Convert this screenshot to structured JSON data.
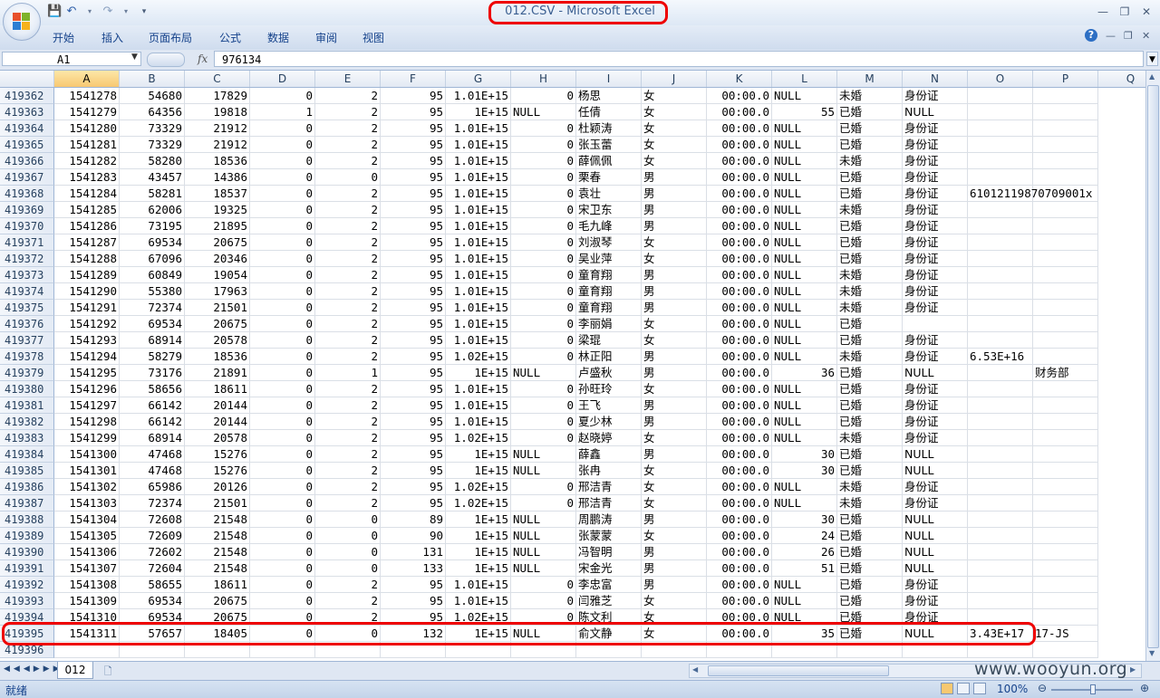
{
  "window": {
    "title": "012.CSV - Microsoft Excel",
    "colors": {
      "accent": "#15428b",
      "highlight": "#e00000",
      "selected_header": "#f7c871"
    }
  },
  "ribbon": {
    "tabs": [
      "开始",
      "插入",
      "页面布局",
      "公式",
      "数据",
      "审阅",
      "视图"
    ]
  },
  "formula_bar": {
    "name_box": "A1",
    "fx": "fx",
    "value": "976134"
  },
  "columns": [
    "A",
    "B",
    "C",
    "D",
    "E",
    "F",
    "G",
    "H",
    "I",
    "J",
    "K",
    "L",
    "M",
    "N",
    "O",
    "P",
    "Q"
  ],
  "rows": [
    [
      "419362",
      "1541278",
      "54680",
      "17829",
      "0",
      "2",
      "95",
      "1.01E+15",
      "0",
      "杨思",
      "女",
      "00:00.0",
      "NULL",
      "未婚",
      "身份证",
      "",
      ""
    ],
    [
      "419363",
      "1541279",
      "64356",
      "19818",
      "1",
      "2",
      "95",
      "1E+15",
      "NULL",
      "任倩",
      "女",
      "00:00.0",
      "55",
      "已婚",
      "NULL",
      "",
      ""
    ],
    [
      "419364",
      "1541280",
      "73329",
      "21912",
      "0",
      "2",
      "95",
      "1.01E+15",
      "0",
      "杜颖涛",
      "女",
      "00:00.0",
      "NULL",
      "已婚",
      "身份证",
      "",
      ""
    ],
    [
      "419365",
      "1541281",
      "73329",
      "21912",
      "0",
      "2",
      "95",
      "1.01E+15",
      "0",
      "张玉蕾",
      "女",
      "00:00.0",
      "NULL",
      "已婚",
      "身份证",
      "",
      ""
    ],
    [
      "419366",
      "1541282",
      "58280",
      "18536",
      "0",
      "2",
      "95",
      "1.01E+15",
      "0",
      "薛佩佩",
      "女",
      "00:00.0",
      "NULL",
      "未婚",
      "身份证",
      "",
      ""
    ],
    [
      "419367",
      "1541283",
      "43457",
      "14386",
      "0",
      "0",
      "95",
      "1.01E+15",
      "0",
      "栗春",
      "男",
      "00:00.0",
      "NULL",
      "已婚",
      "身份证",
      "",
      ""
    ],
    [
      "419368",
      "1541284",
      "58281",
      "18537",
      "0",
      "2",
      "95",
      "1.01E+15",
      "0",
      "袁壮",
      "男",
      "00:00.0",
      "NULL",
      "已婚",
      "身份证",
      "61012119870709001x",
      ""
    ],
    [
      "419369",
      "1541285",
      "62006",
      "19325",
      "0",
      "2",
      "95",
      "1.01E+15",
      "0",
      "宋卫东",
      "男",
      "00:00.0",
      "NULL",
      "未婚",
      "身份证",
      "",
      ""
    ],
    [
      "419370",
      "1541286",
      "73195",
      "21895",
      "0",
      "2",
      "95",
      "1.01E+15",
      "0",
      "毛九峰",
      "男",
      "00:00.0",
      "NULL",
      "已婚",
      "身份证",
      "",
      ""
    ],
    [
      "419371",
      "1541287",
      "69534",
      "20675",
      "0",
      "2",
      "95",
      "1.01E+15",
      "0",
      "刘淑琴",
      "女",
      "00:00.0",
      "NULL",
      "已婚",
      "身份证",
      "",
      ""
    ],
    [
      "419372",
      "1541288",
      "67096",
      "20346",
      "0",
      "2",
      "95",
      "1.01E+15",
      "0",
      "吴业萍",
      "女",
      "00:00.0",
      "NULL",
      "已婚",
      "身份证",
      "",
      ""
    ],
    [
      "419373",
      "1541289",
      "60849",
      "19054",
      "0",
      "2",
      "95",
      "1.01E+15",
      "0",
      "童育翔",
      "男",
      "00:00.0",
      "NULL",
      "未婚",
      "身份证",
      "",
      ""
    ],
    [
      "419374",
      "1541290",
      "55380",
      "17963",
      "0",
      "2",
      "95",
      "1.01E+15",
      "0",
      "童育翔",
      "男",
      "00:00.0",
      "NULL",
      "未婚",
      "身份证",
      "",
      ""
    ],
    [
      "419375",
      "1541291",
      "72374",
      "21501",
      "0",
      "2",
      "95",
      "1.01E+15",
      "0",
      "童育翔",
      "男",
      "00:00.0",
      "NULL",
      "未婚",
      "身份证",
      "",
      ""
    ],
    [
      "419376",
      "1541292",
      "69534",
      "20675",
      "0",
      "2",
      "95",
      "1.01E+15",
      "0",
      "李丽娟",
      "女",
      "00:00.0",
      "NULL",
      "已婚",
      "",
      "",
      ""
    ],
    [
      "419377",
      "1541293",
      "68914",
      "20578",
      "0",
      "2",
      "95",
      "1.01E+15",
      "0",
      "梁琨",
      "女",
      "00:00.0",
      "NULL",
      "已婚",
      "身份证",
      "",
      ""
    ],
    [
      "419378",
      "1541294",
      "58279",
      "18536",
      "0",
      "2",
      "95",
      "1.02E+15",
      "0",
      "林正阳",
      "男",
      "00:00.0",
      "NULL",
      "未婚",
      "身份证",
      "6.53E+16",
      ""
    ],
    [
      "419379",
      "1541295",
      "73176",
      "21891",
      "0",
      "1",
      "95",
      "1E+15",
      "NULL",
      "卢盛秋",
      "男",
      "00:00.0",
      "36",
      "已婚",
      "NULL",
      "",
      "财务部"
    ],
    [
      "419380",
      "1541296",
      "58656",
      "18611",
      "0",
      "2",
      "95",
      "1.01E+15",
      "0",
      "孙旺玲",
      "女",
      "00:00.0",
      "NULL",
      "已婚",
      "身份证",
      "",
      ""
    ],
    [
      "419381",
      "1541297",
      "66142",
      "20144",
      "0",
      "2",
      "95",
      "1.01E+15",
      "0",
      "王飞",
      "男",
      "00:00.0",
      "NULL",
      "已婚",
      "身份证",
      "",
      ""
    ],
    [
      "419382",
      "1541298",
      "66142",
      "20144",
      "0",
      "2",
      "95",
      "1.01E+15",
      "0",
      "夏少林",
      "男",
      "00:00.0",
      "NULL",
      "已婚",
      "身份证",
      "",
      ""
    ],
    [
      "419383",
      "1541299",
      "68914",
      "20578",
      "0",
      "2",
      "95",
      "1.02E+15",
      "0",
      "赵晓婷",
      "女",
      "00:00.0",
      "NULL",
      "未婚",
      "身份证",
      "",
      ""
    ],
    [
      "419384",
      "1541300",
      "47468",
      "15276",
      "0",
      "2",
      "95",
      "1E+15",
      "NULL",
      "薛鑫",
      "男",
      "00:00.0",
      "30",
      "已婚",
      "NULL",
      "",
      ""
    ],
    [
      "419385",
      "1541301",
      "47468",
      "15276",
      "0",
      "2",
      "95",
      "1E+15",
      "NULL",
      "张冉",
      "女",
      "00:00.0",
      "30",
      "已婚",
      "NULL",
      "",
      ""
    ],
    [
      "419386",
      "1541302",
      "65986",
      "20126",
      "0",
      "2",
      "95",
      "1.02E+15",
      "0",
      "邢洁青",
      "女",
      "00:00.0",
      "NULL",
      "未婚",
      "身份证",
      "",
      ""
    ],
    [
      "419387",
      "1541303",
      "72374",
      "21501",
      "0",
      "2",
      "95",
      "1.02E+15",
      "0",
      "邢洁青",
      "女",
      "00:00.0",
      "NULL",
      "未婚",
      "身份证",
      "",
      ""
    ],
    [
      "419388",
      "1541304",
      "72608",
      "21548",
      "0",
      "0",
      "89",
      "1E+15",
      "NULL",
      "周鹏涛",
      "男",
      "00:00.0",
      "30",
      "已婚",
      "NULL",
      "",
      ""
    ],
    [
      "419389",
      "1541305",
      "72609",
      "21548",
      "0",
      "0",
      "90",
      "1E+15",
      "NULL",
      "张蒙蒙",
      "女",
      "00:00.0",
      "24",
      "已婚",
      "NULL",
      "",
      ""
    ],
    [
      "419390",
      "1541306",
      "72602",
      "21548",
      "0",
      "0",
      "131",
      "1E+15",
      "NULL",
      "冯智明",
      "男",
      "00:00.0",
      "26",
      "已婚",
      "NULL",
      "",
      ""
    ],
    [
      "419391",
      "1541307",
      "72604",
      "21548",
      "0",
      "0",
      "133",
      "1E+15",
      "NULL",
      "宋金光",
      "男",
      "00:00.0",
      "51",
      "已婚",
      "NULL",
      "",
      ""
    ],
    [
      "419392",
      "1541308",
      "58655",
      "18611",
      "0",
      "2",
      "95",
      "1.01E+15",
      "0",
      "李忠富",
      "男",
      "00:00.0",
      "NULL",
      "已婚",
      "身份证",
      "",
      ""
    ],
    [
      "419393",
      "1541309",
      "69534",
      "20675",
      "0",
      "2",
      "95",
      "1.01E+15",
      "0",
      "闫雅芝",
      "女",
      "00:00.0",
      "NULL",
      "已婚",
      "身份证",
      "",
      ""
    ],
    [
      "419394",
      "1541310",
      "69534",
      "20675",
      "0",
      "2",
      "95",
      "1.02E+15",
      "0",
      "陈文利",
      "女",
      "00:00.0",
      "NULL",
      "已婚",
      "身份证",
      "",
      ""
    ],
    [
      "419395",
      "1541311",
      "57657",
      "18405",
      "0",
      "0",
      "132",
      "1E+15",
      "NULL",
      "俞文静",
      "女",
      "00:00.0",
      "35",
      "已婚",
      "NULL",
      "3.43E+17",
      "17-JS"
    ],
    [
      "419396",
      "",
      "",
      "",
      "",
      "",
      "",
      "",
      "",
      "",
      "",
      "",
      "",
      "",
      "",
      "",
      ""
    ]
  ],
  "sheet_tabs": [
    "012"
  ],
  "status": {
    "ready": "就绪",
    "zoom": "100%"
  },
  "watermark": "www.wooyun.org"
}
